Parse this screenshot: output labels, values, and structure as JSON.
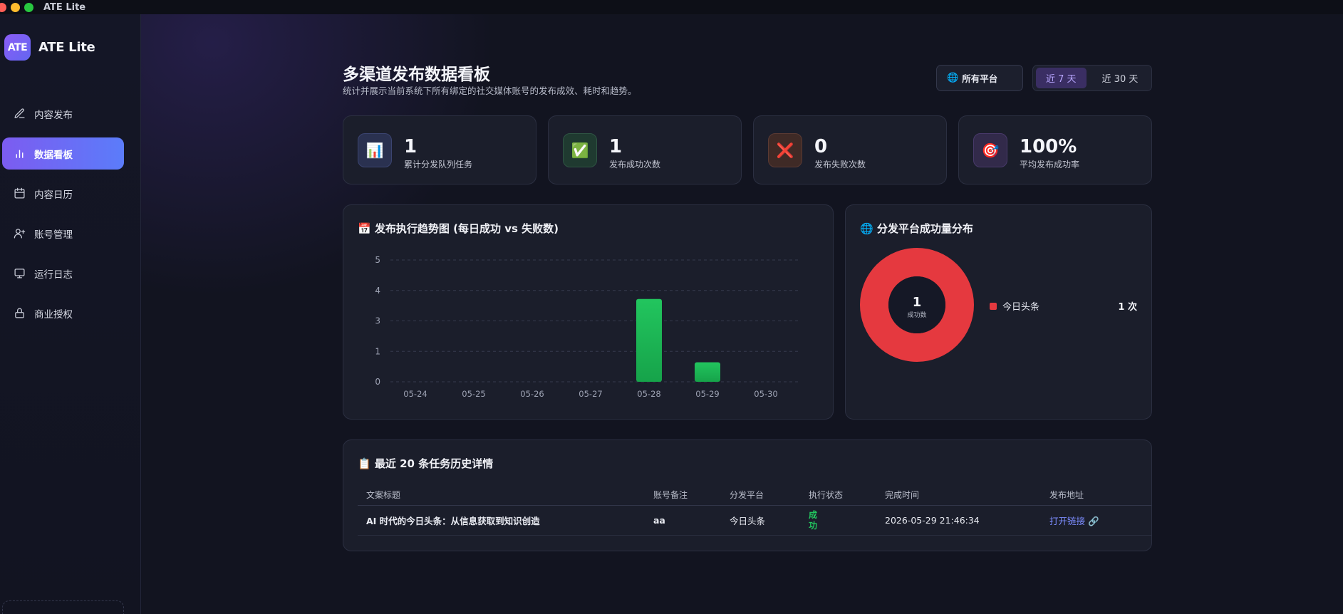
{
  "window": {
    "title": "ATE Lite"
  },
  "sidebar": {
    "logo": "ATE",
    "brand": "ATE Lite",
    "items": [
      {
        "label": "内容发布",
        "icon": "pen-icon"
      },
      {
        "label": "数据看板",
        "icon": "bar-chart-icon",
        "active": true
      },
      {
        "label": "内容日历",
        "icon": "calendar-icon"
      },
      {
        "label": "账号管理",
        "icon": "user-plus-icon"
      },
      {
        "label": "运行日志",
        "icon": "monitor-icon"
      },
      {
        "label": "商业授权",
        "icon": "lock-icon"
      }
    ]
  },
  "header": {
    "title": "多渠道发布数据看板",
    "subtitle": "统计并展示当前系统下所有绑定的社交媒体账号的发布成效、耗时和趋势。",
    "platform_select": "所有平台",
    "range_options": [
      "近 7 天",
      "近 30 天"
    ],
    "range_selected": "近 7 天"
  },
  "stats": [
    {
      "value": "1",
      "label": "累计分发队列任务",
      "icon": "📊",
      "color": "#2a3150"
    },
    {
      "value": "1",
      "label": "发布成功次数",
      "icon": "✅",
      "color": "#1f3a30"
    },
    {
      "value": "0",
      "label": "发布失败次数",
      "icon": "❌",
      "color": "#3f2a26"
    },
    {
      "value": "100%",
      "label": "平均发布成功率",
      "icon": "🎯",
      "color": "#322a4a"
    }
  ],
  "trend_chart": {
    "title": "📅 发布执行趋势图 (每日成功 vs 失败数)"
  },
  "distribution_chart": {
    "title": "🌐 分发平台成功量分布",
    "center_value": "1",
    "center_label": "成功数"
  },
  "chart_data": [
    {
      "type": "bar",
      "title": "📅 发布执行趋势图 (每日成功 vs 失败数)",
      "categories": [
        "05-24",
        "05-25",
        "05-26",
        "05-27",
        "05-28",
        "05-29",
        "05-30"
      ],
      "values": [
        0,
        0,
        0,
        0,
        3.4,
        0.8,
        0
      ],
      "ytick_labels": [
        "0",
        "1",
        "3",
        "4",
        "5"
      ],
      "ylim": [
        0,
        5
      ],
      "grid": true,
      "color": "#22c55e"
    },
    {
      "type": "pie",
      "title": "🌐 分发平台成功量分布",
      "labels": [
        "今日头条"
      ],
      "values": [
        1
      ],
      "value_labels": [
        "1 次"
      ],
      "colors": [
        "#e5393f"
      ],
      "legend": "right"
    }
  ],
  "table": {
    "title": "📋 最近 20 条任务历史详情",
    "columns": [
      "文案标题",
      "账号备注",
      "分发平台",
      "执行状态",
      "完成时间",
      "发布地址"
    ],
    "rows": [
      {
        "title": "AI 时代的今日头条：从信息获取到知识创造",
        "account": "aa",
        "platform": "今日头条",
        "status": "成功",
        "time": "2026-05-29 21:46:34",
        "link": "打开链接 🔗"
      }
    ]
  },
  "colors": {
    "accent": "#7c5cf0",
    "success": "#22c55e",
    "danger": "#e5393f",
    "link": "#7c8cff"
  }
}
